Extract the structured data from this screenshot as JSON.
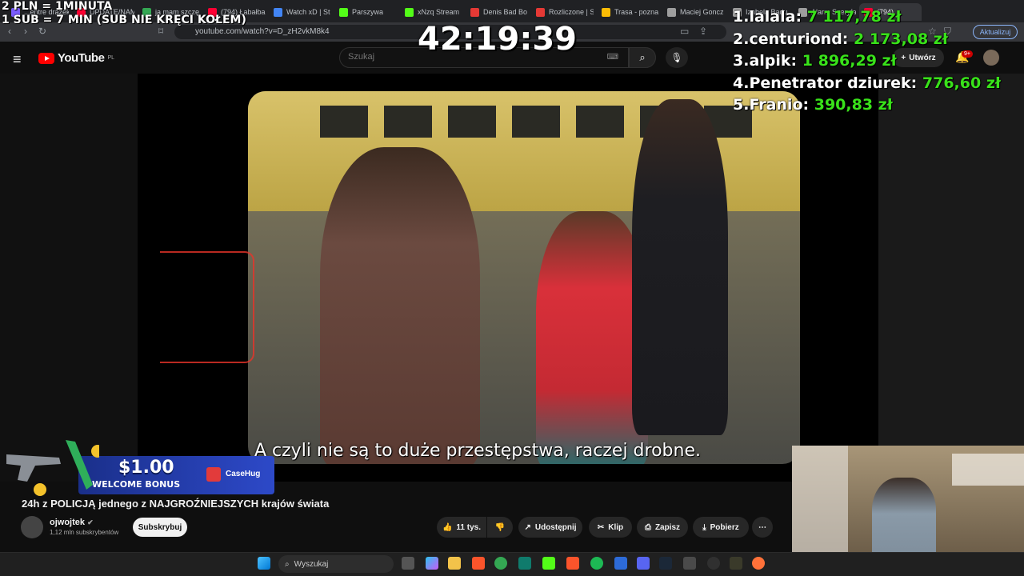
{
  "browser": {
    "tabs": [
      {
        "label": "...entre drazek",
        "color": "#7a5cff"
      },
      {
        "label": "UPDATE/NAME 3",
        "color": "#ff0033"
      },
      {
        "label": "ja mam szczę...",
        "color": "#34a853"
      },
      {
        "label": "(794) Łabałba",
        "color": "#ff0033"
      },
      {
        "label": "Watch xD | St",
        "color": "#4285f4"
      },
      {
        "label": "Parszywa",
        "color": "#53fc18"
      },
      {
        "label": "xNzq Stream",
        "color": "#53fc18"
      },
      {
        "label": "Denis Bad Bo",
        "color": "#e53935"
      },
      {
        "label": "Rozliczone | S",
        "color": "#e53935"
      },
      {
        "label": "Trasa - pozna",
        "color": "#fbbc05"
      },
      {
        "label": "Maciej Goncz",
        "color": "#9e9e9e"
      },
      {
        "label": "Izabela Badu",
        "color": "#9e9e9e"
      },
      {
        "label": "Alarm Szeryfa",
        "color": "#9e9e9e"
      },
      {
        "label": "(794)",
        "color": "#ff0033"
      }
    ],
    "url": "youtube.com/watch?v=D_zH2vkM8k4",
    "update_label": "Aktualizuj"
  },
  "overlay": {
    "rule1": "2 PLN = 1MINUTA",
    "rule2": "1 SUB = 7 MIN (SUB NIE KRĘCI KOŁEM)",
    "timer": "42:19:39",
    "donors": [
      {
        "rank": "1.",
        "name": "lalala:",
        "amount": "7 117,78 zł"
      },
      {
        "rank": "2.",
        "name": "centuriond:",
        "amount": "2 173,08 zł"
      },
      {
        "rank": "3.",
        "name": "alpik:",
        "amount": "1 896,29 zł"
      },
      {
        "rank": "4.",
        "name": "Penetrator dziurek:",
        "amount": "776,60 zł"
      },
      {
        "rank": "5.",
        "name": "Franio:",
        "amount": "390,83 zł"
      }
    ]
  },
  "youtube": {
    "logo_text": "YouTube",
    "logo_region": "PL",
    "search_placeholder": "Szukaj",
    "create_label": "Utwórz",
    "notifications_badge": "9+",
    "subtitle": "A czyli nie są to duże przestępstwa, raczej drobne.",
    "video_title": "24h z POLICJĄ jednego z NAJGROŹNIEJSZYCH krajów świata",
    "channel_name": "ojwojtek",
    "channel_subs": "1,12 mln subskrybentów",
    "subscribe_label": "Subskrybuj",
    "likes": "11 tys.",
    "share_label": "Udostępnij",
    "clip_label": "Klip",
    "save_label": "Zapisz",
    "download_label": "Pobierz"
  },
  "promo": {
    "amount": "$1.00",
    "label": "WELCOME BONUS",
    "brand": "CaseHug"
  },
  "taskbar": {
    "search_placeholder": "Wyszukaj"
  }
}
